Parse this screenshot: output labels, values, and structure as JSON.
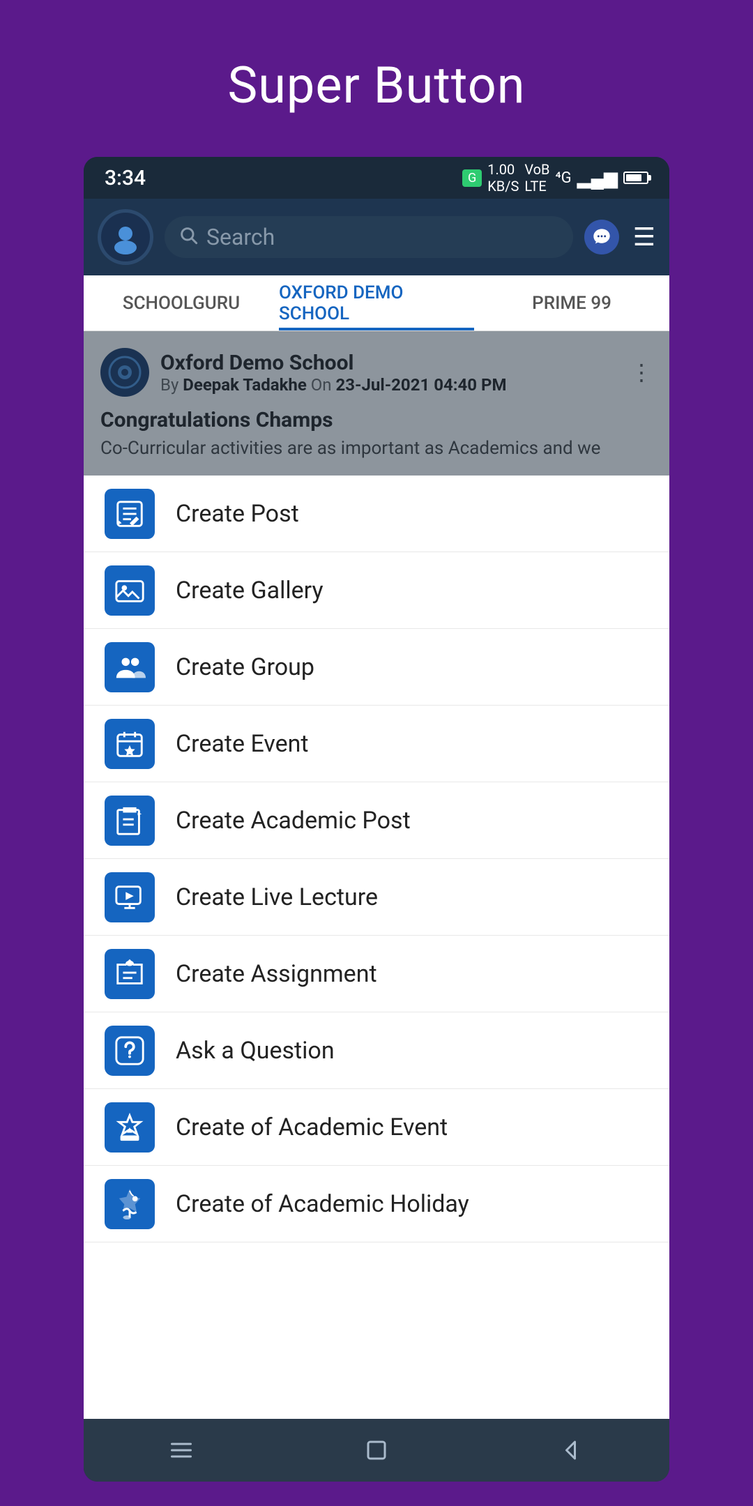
{
  "page": {
    "title": "Super Button"
  },
  "status_bar": {
    "time": "3:34",
    "badge_label": "G",
    "signal_text": "1.00 KB/S",
    "network": "4G"
  },
  "header": {
    "search_placeholder": "Search",
    "chat_icon": "chat-bubble-icon",
    "menu_icon": "hamburger-icon"
  },
  "tabs": [
    {
      "id": "schoolguru",
      "label": "SCHOOLGURU",
      "active": false
    },
    {
      "id": "oxford",
      "label": "OXFORD DEMO SCHOOL",
      "active": true
    },
    {
      "id": "prime",
      "label": "PRIME 99",
      "active": false
    }
  ],
  "post": {
    "school_name": "Oxford Demo School",
    "author": "Deepak Tadakhe",
    "date": "23-Jul-2021 04:40 PM",
    "title": "Congratulations Champs",
    "body": "Co-Curricular activities are as important as Academics and we"
  },
  "menu_items": [
    {
      "id": "create-post",
      "label": "Create Post",
      "icon": "post-icon"
    },
    {
      "id": "create-gallery",
      "label": "Create Gallery",
      "icon": "gallery-icon"
    },
    {
      "id": "create-group",
      "label": "Create Group",
      "icon": "group-icon"
    },
    {
      "id": "create-event",
      "label": "Create Event",
      "icon": "event-icon"
    },
    {
      "id": "create-academic-post",
      "label": "Create Academic Post",
      "icon": "academic-post-icon"
    },
    {
      "id": "create-live-lecture",
      "label": "Create Live Lecture",
      "icon": "live-lecture-icon"
    },
    {
      "id": "create-assignment",
      "label": "Create Assignment",
      "icon": "assignment-icon"
    },
    {
      "id": "ask-question",
      "label": "Ask a Question",
      "icon": "question-icon"
    },
    {
      "id": "create-academic-event",
      "label": "Create of Academic Event",
      "icon": "academic-event-icon"
    },
    {
      "id": "create-academic-holiday",
      "label": "Create of Academic Holiday",
      "icon": "academic-holiday-icon"
    }
  ]
}
